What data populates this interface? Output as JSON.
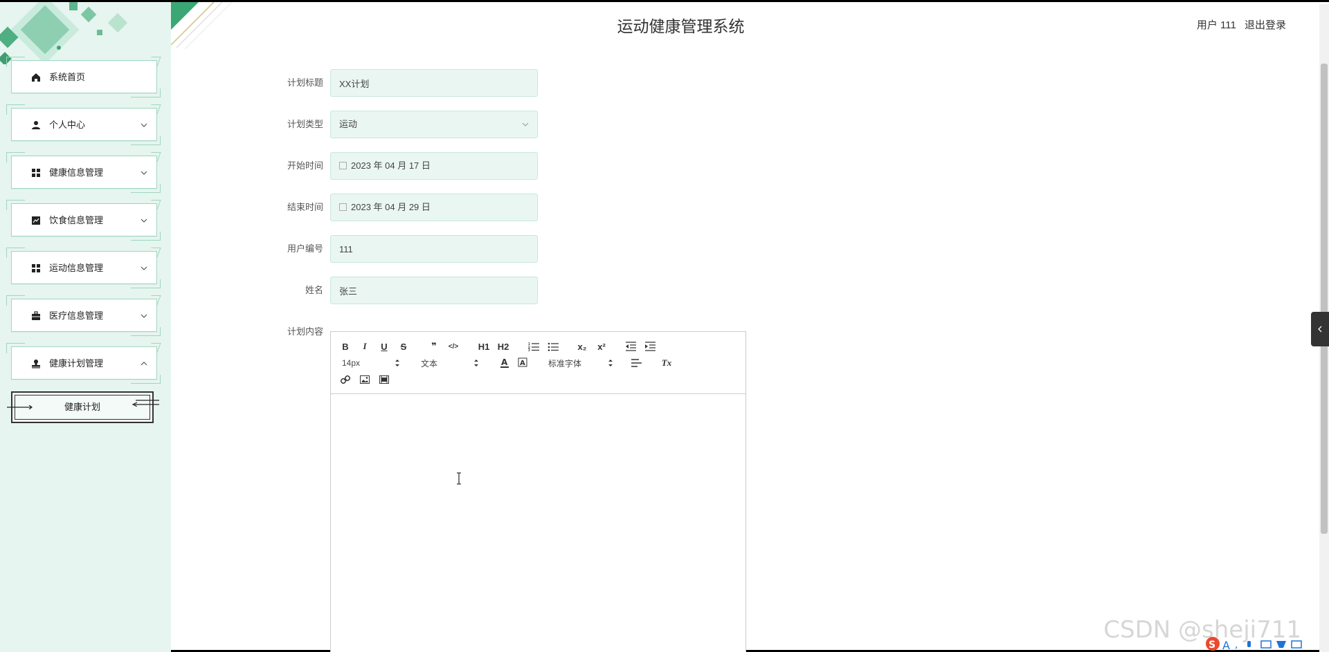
{
  "header": {
    "title": "运动健康管理系统",
    "user_label": "用户 111",
    "logout_label": "退出登录"
  },
  "sidebar": {
    "items": [
      {
        "label": "系统首页",
        "icon": "home-icon",
        "expandable": false
      },
      {
        "label": "个人中心",
        "icon": "user-icon",
        "expandable": true,
        "expanded": false
      },
      {
        "label": "健康信息管理",
        "icon": "grid-icon",
        "expandable": true,
        "expanded": false
      },
      {
        "label": "饮食信息管理",
        "icon": "chart-icon",
        "expandable": true,
        "expanded": false
      },
      {
        "label": "运动信息管理",
        "icon": "grid-icon",
        "expandable": true,
        "expanded": false
      },
      {
        "label": "医疗信息管理",
        "icon": "briefcase-icon",
        "expandable": true,
        "expanded": false
      },
      {
        "label": "健康计划管理",
        "icon": "stamp-icon",
        "expandable": true,
        "expanded": true
      }
    ],
    "sub_items": [
      {
        "label": "健康计划",
        "active": true
      }
    ]
  },
  "form": {
    "title": {
      "label": "计划标题",
      "value": "XX计划"
    },
    "type": {
      "label": "计划类型",
      "value": "运动"
    },
    "start": {
      "label": "开始时间",
      "value": "2023 年 04 月 17 日"
    },
    "end": {
      "label": "结束时间",
      "value": "2023 年 04 月 29 日"
    },
    "user_no": {
      "label": "用户编号",
      "value": "111"
    },
    "name": {
      "label": "姓名",
      "value": "张三"
    },
    "content": {
      "label": "计划内容"
    }
  },
  "editor": {
    "font_size": "14px",
    "header_select": "文本",
    "font_family": "标准字体",
    "buttons": {
      "h1": "H1",
      "h2": "H2",
      "sub": "x₂",
      "sup": "x²",
      "clean": "Tx",
      "bold": "B",
      "italic": "I",
      "underline": "U",
      "strike": "S",
      "quote": "❞",
      "code": "</>"
    }
  },
  "watermark": "CSDN @sheji711",
  "colors": {
    "sidebar_bg": "#e6f5ef",
    "accent_green": "#3aa774",
    "input_bg": "#eaf6f1",
    "input_border": "#c7e8d9"
  }
}
